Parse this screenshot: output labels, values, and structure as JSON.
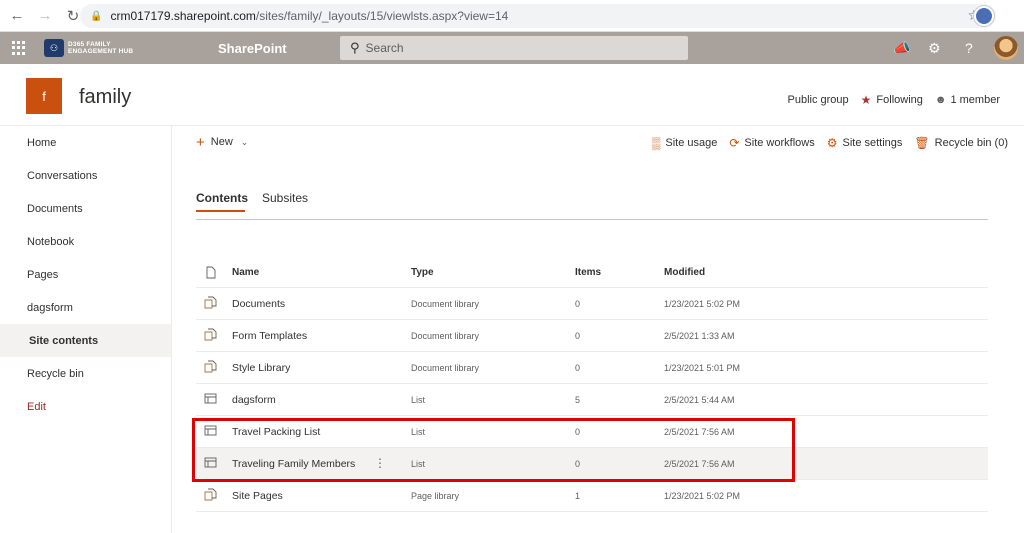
{
  "browser": {
    "url_host": "crm017179.sharepoint.com",
    "url_path": "/sites/family/_layouts/15/viewlsts.aspx?view=14"
  },
  "suitebar": {
    "brand_line1": "D365 FAMILY",
    "brand_line2": "ENGAGEMENT HUB",
    "app_name": "SharePoint",
    "search_placeholder": "Search"
  },
  "site": {
    "logo_letter": "f",
    "title": "family",
    "privacy": "Public group",
    "following": "Following",
    "members": "1 member"
  },
  "leftnav": {
    "items": [
      {
        "label": "Home"
      },
      {
        "label": "Conversations"
      },
      {
        "label": "Documents"
      },
      {
        "label": "Notebook"
      },
      {
        "label": "Pages"
      },
      {
        "label": "dagsform"
      },
      {
        "label": "Site contents"
      },
      {
        "label": "Recycle bin"
      },
      {
        "label": "Edit"
      }
    ]
  },
  "commandbar": {
    "new_label": "New",
    "site_usage": "Site usage",
    "site_workflows": "Site workflows",
    "site_settings": "Site settings",
    "recycle_bin": "Recycle bin (0)"
  },
  "pivot": {
    "tabs": [
      {
        "label": "Contents"
      },
      {
        "label": "Subsites"
      }
    ]
  },
  "table": {
    "headers": {
      "name": "Name",
      "type": "Type",
      "items": "Items",
      "modified": "Modified"
    },
    "rows": [
      {
        "name": "Documents",
        "type": "Document library",
        "items": "0",
        "modified": "1/23/2021 5:02 PM",
        "icon": "library-icon"
      },
      {
        "name": "Form Templates",
        "type": "Document library",
        "items": "0",
        "modified": "2/5/2021 1:33 AM",
        "icon": "library-icon"
      },
      {
        "name": "Style Library",
        "type": "Document library",
        "items": "0",
        "modified": "1/23/2021 5:01 PM",
        "icon": "library-icon"
      },
      {
        "name": "dagsform",
        "type": "List",
        "items": "5",
        "modified": "2/5/2021 5:44 AM",
        "icon": "list-icon"
      },
      {
        "name": "Travel Packing List",
        "type": "List",
        "items": "0",
        "modified": "2/5/2021 7:56 AM",
        "icon": "list-icon"
      },
      {
        "name": "Traveling Family Members",
        "type": "List",
        "items": "0",
        "modified": "2/5/2021 7:56 AM",
        "icon": "list-icon"
      },
      {
        "name": "Site Pages",
        "type": "Page library",
        "items": "1",
        "modified": "1/23/2021 5:02 PM",
        "icon": "library-icon"
      }
    ]
  },
  "colors": {
    "accent": "#ca5010",
    "suitebar": "#a8a19c",
    "highlight": "#e00000"
  }
}
